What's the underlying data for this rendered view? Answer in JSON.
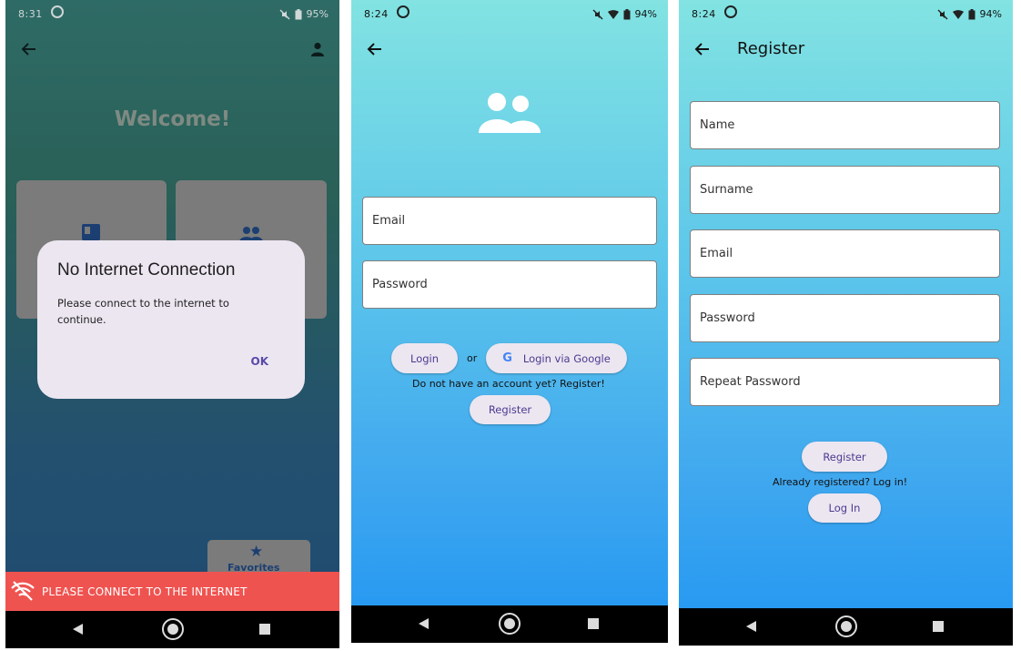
{
  "phone1": {
    "status": {
      "time": "8:31",
      "battery": "95%"
    },
    "welcome": "Welcome!",
    "dialog": {
      "title": "No Internet Connection",
      "message": "Please connect to the internet to continue.",
      "ok": "OK"
    },
    "favorites_label": "Favorites",
    "snackbar": "PLEASE CONNECT TO THE INTERNET"
  },
  "phone2": {
    "status": {
      "time": "8:24",
      "battery": "94%"
    },
    "email_placeholder": "Email",
    "password_placeholder": "Password",
    "login": "Login",
    "or": "or",
    "google_letter": "G",
    "google_login": "Login via Google",
    "no_account": "Do not have an account yet? Register!",
    "register": "Register"
  },
  "phone3": {
    "status": {
      "time": "8:24",
      "battery": "94%"
    },
    "title": "Register",
    "name_placeholder": "Name",
    "surname_placeholder": "Surname",
    "email_placeholder": "Email",
    "password_placeholder": "Password",
    "repeat_password_placeholder": "Repeat Password",
    "register": "Register",
    "already": "Already registered? Log in!",
    "login": "Log In"
  },
  "colors": {
    "snackbar": "#ef5350",
    "dialog_bg": "#ece6f1",
    "accent_text": "#4a3b8f",
    "card_grey": "#7b7b7b"
  },
  "icons": [
    "back-arrow-icon",
    "person-icon",
    "group-icon",
    "book-icon",
    "star-icon",
    "wifi-off-icon",
    "google-icon",
    "nav-back-icon",
    "nav-home-icon",
    "nav-recents-icon"
  ]
}
